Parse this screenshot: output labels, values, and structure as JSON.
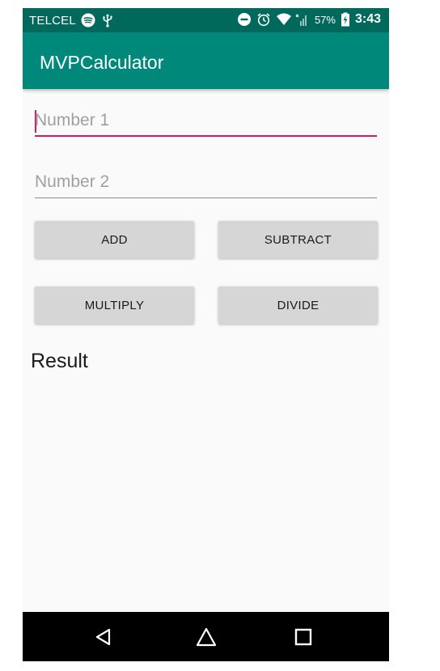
{
  "status_bar": {
    "carrier": "TELCEL",
    "battery_percent": "57%",
    "time": "3:43",
    "icons": [
      "spotify-icon",
      "usb-icon",
      "do-not-disturb-icon",
      "alarm-icon",
      "wifi-icon",
      "signal-icon",
      "battery-charging-icon"
    ]
  },
  "app_bar": {
    "title": "MVPCalculator",
    "color": "#00897b",
    "status_color": "#00695c"
  },
  "inputs": {
    "number1": {
      "placeholder": "Number 1",
      "value": ""
    },
    "number2": {
      "placeholder": "Number 2",
      "value": ""
    }
  },
  "buttons": {
    "add": "ADD",
    "subtract": "SUBTRACT",
    "multiply": "MULTIPLY",
    "divide": "DIVIDE"
  },
  "result": {
    "label": "Result"
  },
  "nav_bar": {
    "icons": [
      "back-icon",
      "home-icon",
      "recents-icon"
    ]
  },
  "accent_color": "#d81b60"
}
